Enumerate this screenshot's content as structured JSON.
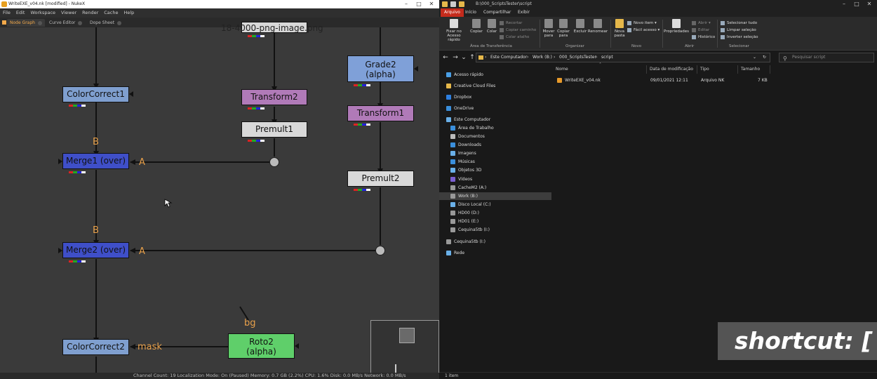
{
  "nuke": {
    "title": "WriteEXE_v04.nk [modified] - NukeX",
    "menu": [
      "File",
      "Edit",
      "Workspace",
      "Viewer",
      "Render",
      "Cache",
      "Help"
    ],
    "tabs": [
      "Node Graph",
      "Curve Editor",
      "Dope Sheet"
    ],
    "top_label": "18-4000-png-image.png",
    "nodes": {
      "colorcorrect1": "ColorCorrect1",
      "transform2": "Transform2",
      "premult1": "Premult1",
      "grade2_line1": "Grade2",
      "grade2_line2": "(alpha)",
      "transform1": "Transform1",
      "premult2": "Premult2",
      "merge1": "Merge1 (over)",
      "merge2": "Merge2 (over)",
      "colorcorrect2": "ColorCorrect2",
      "roto2_line1": "Roto2",
      "roto2_line2": "(alpha)"
    },
    "input_labels": {
      "merge1_b": "B",
      "merge1_a": "A",
      "merge2_b": "B",
      "merge2_a": "A",
      "cc2_mask": "mask",
      "roto_bg": "bg"
    },
    "status": "Channel Count: 19  Localization Mode: On (Paused)  Memory: 0.7 GB (2.2%)  CPU: 1.6%  Disk: 0.0 MB/s  Network: 0.0 MB/s"
  },
  "explorer": {
    "title_path": "B:\\000_ScriptsTester\\script",
    "ribbon_tabs": [
      "Arquivo",
      "Início",
      "Compartilhar",
      "Exibir"
    ],
    "ribbon": {
      "pin": "Fixar no Acesso rápido",
      "copy": "Copiar",
      "paste": "Colar",
      "cut": "Recortar",
      "copy_path": "Copiar caminho",
      "paste_shortcut": "Colar atalho",
      "move_to": "Mover para",
      "copy_to": "Copiar para",
      "delete": "Excluir",
      "rename": "Renomear",
      "new_folder": "Nova pasta",
      "new_item": "Novo item ▾",
      "easy_access": "Fácil acesso ▾",
      "properties": "Propriedades",
      "open": "Abrir ▾",
      "edit": "Editar",
      "history": "Histórico",
      "select_all": "Selecionar tudo",
      "clear_selection": "Limpar seleção",
      "invert_selection": "Inverter seleção",
      "group_clipboard": "Área de Transferência",
      "group_organize": "Organizar",
      "group_new": "Novo",
      "group_open": "Abrir",
      "group_select": "Selecionar"
    },
    "breadcrumb": [
      "Este Computador",
      "Work (B:)",
      "000_ScriptsTester",
      "script"
    ],
    "search_placeholder": "Pesquisar script",
    "nav_items": [
      "Acesso rápido",
      "Creative Cloud Files",
      "Dropbox",
      "OneDrive",
      "Este Computador",
      "Área de Trabalho",
      "Documentos",
      "Downloads",
      "Imagens",
      "Músicas",
      "Objetos 3D",
      "Vídeos",
      "CacheM2 (A:)",
      "Work (B:)",
      "Disco Local (C:)",
      "HD00 (D:)",
      "HD01 (E:)",
      "Cequina5tb (I:)",
      "Cequina5tb (I:)",
      "Rede"
    ],
    "columns": [
      "Nome",
      "Data de modificação",
      "Tipo",
      "Tamanho"
    ],
    "files": [
      {
        "name": "WriteEXE_v04.nk",
        "date": "09/01/2021 12:11",
        "type": "Arquivo NK",
        "size": "7 KB"
      }
    ],
    "status": "1 item"
  },
  "overlay": {
    "shortcut": "shortcut: ["
  }
}
